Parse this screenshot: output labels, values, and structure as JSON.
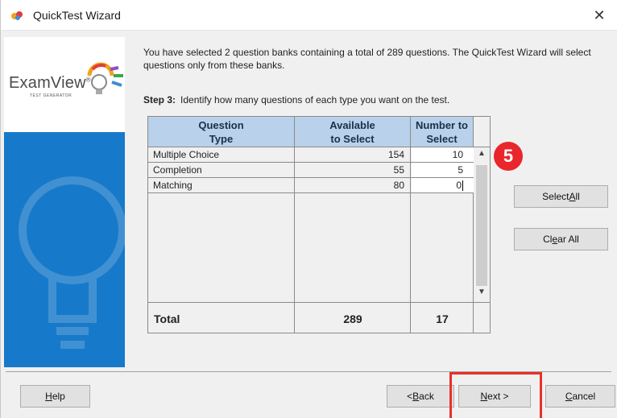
{
  "window": {
    "title": "QuickTest Wizard",
    "close_glyph": "✕"
  },
  "logo": {
    "name": "ExamView",
    "trademark": "®",
    "subtitle": "TEST GENERATOR"
  },
  "intro_text": "You have selected 2 question banks containing a total of 289 questions.  The QuickTest Wizard will select questions only from these banks.",
  "step": {
    "label": "Step 3:",
    "text": "Identify how many questions of each type you want on the test."
  },
  "table": {
    "headers": {
      "type_line1": "Question",
      "type_line2": "Type",
      "available_line1": "Available",
      "available_line2": "to Select",
      "number_line1": "Number to",
      "number_line2": "Select"
    },
    "rows": [
      {
        "type": "Multiple Choice",
        "available": "154",
        "number": "10"
      },
      {
        "type": "Completion",
        "available": "55",
        "number": "5"
      },
      {
        "type": "Matching",
        "available": "80",
        "number": "0"
      }
    ],
    "total": {
      "label": "Total",
      "available": "289",
      "number": "17"
    }
  },
  "callout_badge": "5",
  "buttons": {
    "select_all": {
      "pre": "Select ",
      "key": "A",
      "post": "ll"
    },
    "clear_all": {
      "pre": "Cl",
      "key": "e",
      "post": "ar All"
    },
    "help": {
      "pre": "",
      "key": "H",
      "post": "elp"
    },
    "back": {
      "pre": "< ",
      "key": "B",
      "post": "ack"
    },
    "next": {
      "pre": "",
      "key": "N",
      "post": "ext >"
    },
    "cancel": {
      "pre": "",
      "key": "C",
      "post": "ancel"
    }
  },
  "colors": {
    "sidebar": "#1779c9",
    "header_fill": "#b9d1ea",
    "badge": "#e8262c",
    "highlight": "#e8302a"
  }
}
